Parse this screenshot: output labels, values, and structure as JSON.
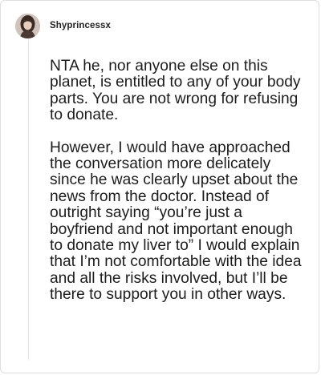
{
  "post": {
    "username": "Shyprincessx",
    "avatar_icon": "user-avatar",
    "paragraphs": [
      "NTA he, nor anyone else on this planet, is entitled to any of your body parts. You are not wrong for refusing to donate.",
      "However, I would have approached the conversation more delicately since he was clearly upset about the news from the doctor. Instead of outright saying “you’re just a boyfriend and not important enough to donate my liver to” I would explain that I’m not comfortable with the idea and all the risks involved, but I’ll be there to support you in other ways."
    ]
  }
}
